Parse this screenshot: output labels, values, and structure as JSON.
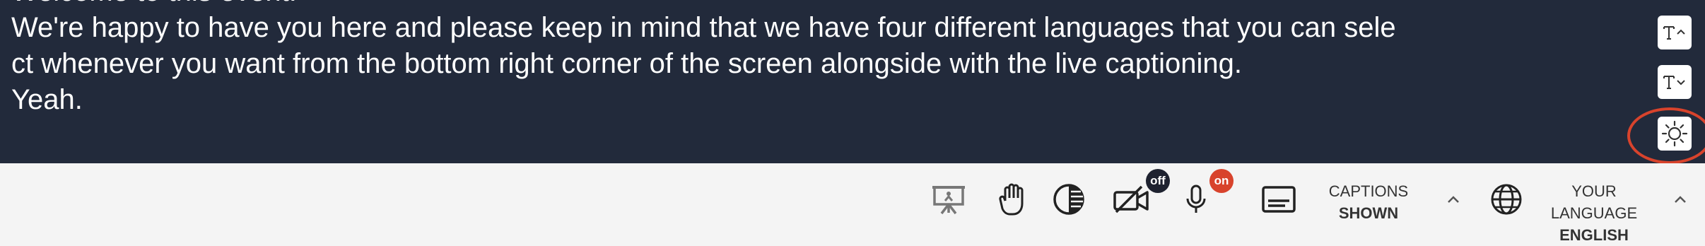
{
  "captions": {
    "lines": [
      "Welcome to this event.",
      "We're happy to have you here and please keep in mind that we have four different languages that you can sele",
      "ct whenever you want from the bottom right corner of the screen alongside with the live captioning.",
      "Yeah."
    ]
  },
  "caption_controls": {
    "increase_font_icon": "T^",
    "decrease_font_icon": "Tv",
    "theme_toggle_icon": "sun-icon"
  },
  "toolbar": {
    "camera_badge": "off",
    "mic_badge": "on",
    "captions_label": "CAPTIONS",
    "captions_state": "SHOWN",
    "language_label": "YOUR LANGUAGE",
    "language_value": "ENGLISH"
  },
  "colors": {
    "caption_background": "#222a3b",
    "caption_text": "#ffffff",
    "toolbar_background": "#f4f4f4",
    "badge_dark": "#1e2230",
    "badge_red": "#d8432c",
    "highlight_ring": "#d8432c"
  }
}
